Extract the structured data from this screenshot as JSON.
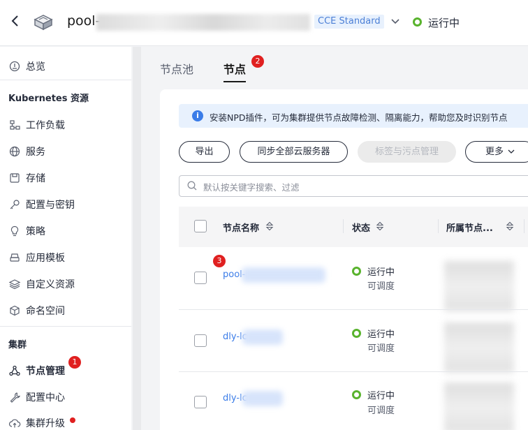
{
  "header": {
    "cluster_name": "pool-",
    "cluster_badge": "CCE Standard",
    "status": "运行中",
    "status_color": "#59b32d"
  },
  "sidebar": {
    "items_top": [
      {
        "label": "总览",
        "icon": "overview-icon"
      }
    ],
    "group_kubernetes": "Kubernetes 资源",
    "items_k8s": [
      {
        "label": "工作负载",
        "icon": "workload-icon"
      },
      {
        "label": "服务",
        "icon": "globe-icon"
      },
      {
        "label": "存储",
        "icon": "storage-icon"
      },
      {
        "label": "配置与密钥",
        "icon": "key-icon"
      },
      {
        "label": "策略",
        "icon": "policy-icon"
      },
      {
        "label": "应用模板",
        "icon": "template-icon"
      },
      {
        "label": "自定义资源",
        "icon": "layers-icon"
      },
      {
        "label": "命名空间",
        "icon": "cube-icon"
      }
    ],
    "group_cluster": "集群",
    "items_cluster": [
      {
        "label": "节点管理",
        "icon": "node-icon",
        "active": true,
        "badge": "1"
      },
      {
        "label": "配置中心",
        "icon": "wrench-icon"
      },
      {
        "label": "集群升级",
        "icon": "cloud-upgrade-icon",
        "dot": true
      }
    ]
  },
  "tabs": [
    {
      "label": "节点池",
      "active": false
    },
    {
      "label": "节点",
      "active": true,
      "badge": "2"
    }
  ],
  "notice": {
    "text": "安装NPD插件，可为集群提供节点故障检测、隔离能力，帮助您及时识别节点"
  },
  "toolbar": {
    "export": "导出",
    "sync": "同步全部云服务器",
    "labels_taints": "标签与污点管理",
    "more": "更多"
  },
  "search": {
    "placeholder": "默认按关键字搜索、过滤"
  },
  "table": {
    "columns": [
      "节点名称",
      "状态",
      "所属节点..."
    ],
    "rows": [
      {
        "name": "pool-",
        "status": "运行中",
        "schedulable": "可调度",
        "badge": "3"
      },
      {
        "name": "dly-lc",
        "status": "运行中",
        "schedulable": "可调度"
      },
      {
        "name": "dly-lc",
        "status": "运行中",
        "schedulable": "可调度"
      }
    ]
  },
  "colors": {
    "accent": "#3a7ce8",
    "badge_red": "#e02020",
    "running_green": "#59b32d"
  }
}
